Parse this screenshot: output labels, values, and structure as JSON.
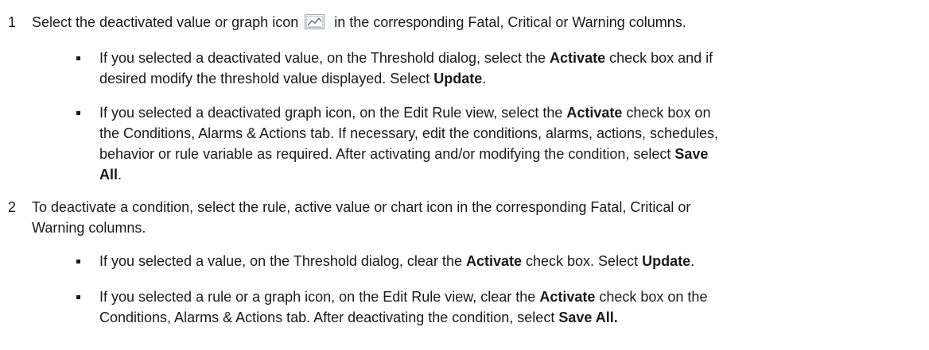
{
  "steps": [
    {
      "num": "1",
      "text_before_icon": "Select the deactivated value or graph icon",
      "icon": "graph-icon",
      "text_after_icon": "in the corresponding Fatal, Critical or Warning columns.",
      "bullets": [
        {
          "t1": "If you selected a deactivated value, on the Threshold dialog, select the ",
          "b1": "Activate",
          "t2": " check box and if",
          "t3": "desired modify the threshold value displayed. Select ",
          "b2": "Update",
          "t4": "."
        },
        {
          "t1": "If you selected a deactivated graph icon, on the Edit Rule view, select the ",
          "b1": "Activate",
          "t2": " check box on",
          "t3": "the Conditions, Alarms & Actions tab. If necessary, edit the conditions, alarms, actions, schedules,",
          "t4": "behavior or rule variable as required. After activating and/or modifying the condition, select ",
          "b2": "Save",
          "b3": "All",
          "t5": "."
        }
      ]
    },
    {
      "num": "2",
      "line1": "To deactivate a condition, select the rule, active value or chart icon in the corresponding Fatal, Critical or",
      "line2": "Warning columns.",
      "bullets": [
        {
          "t1": "If you selected a value, on the Threshold dialog, clear the ",
          "b1": "Activate",
          "t2": " check box. Select ",
          "b2": "Update",
          "t3": "."
        },
        {
          "t1": "If you selected a rule or a graph icon, on the Edit Rule view, clear the ",
          "b1": "Activate",
          "t2": " check box on the",
          "t3": "Conditions, Alarms & Actions tab. After deactivating the condition, select ",
          "b2": "Save All."
        }
      ]
    }
  ]
}
